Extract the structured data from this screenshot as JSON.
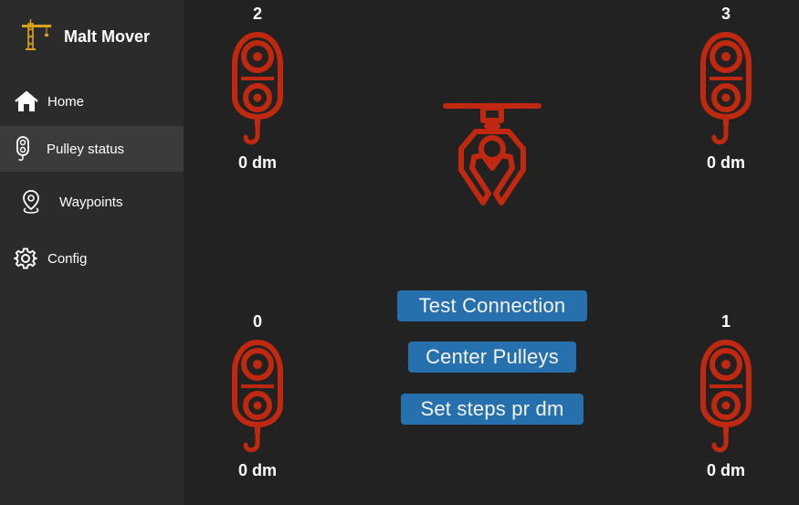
{
  "app": {
    "title": "Malt Mover"
  },
  "sidebar": {
    "items": [
      {
        "label": "Home",
        "icon": "home-icon"
      },
      {
        "label": "Pulley status",
        "icon": "pulley-icon",
        "active": true
      },
      {
        "label": "Waypoints",
        "icon": "map-pin-icon"
      },
      {
        "label": "Config",
        "icon": "gear-icon"
      }
    ]
  },
  "pulleys": [
    {
      "id": "2",
      "distance": "0 dm"
    },
    {
      "id": "3",
      "distance": "0 dm"
    },
    {
      "id": "0",
      "distance": "0 dm"
    },
    {
      "id": "1",
      "distance": "0 dm"
    }
  ],
  "buttons": {
    "test_connection": "Test Connection",
    "center_pulleys": "Center Pulleys",
    "set_steps": "Set steps pr dm"
  },
  "colors": {
    "accent": "#c0280f",
    "button": "#2770ae",
    "sidebar_bg": "#2b2b2b",
    "sidebar_active": "#3b3b3b",
    "main_bg": "#222222"
  }
}
